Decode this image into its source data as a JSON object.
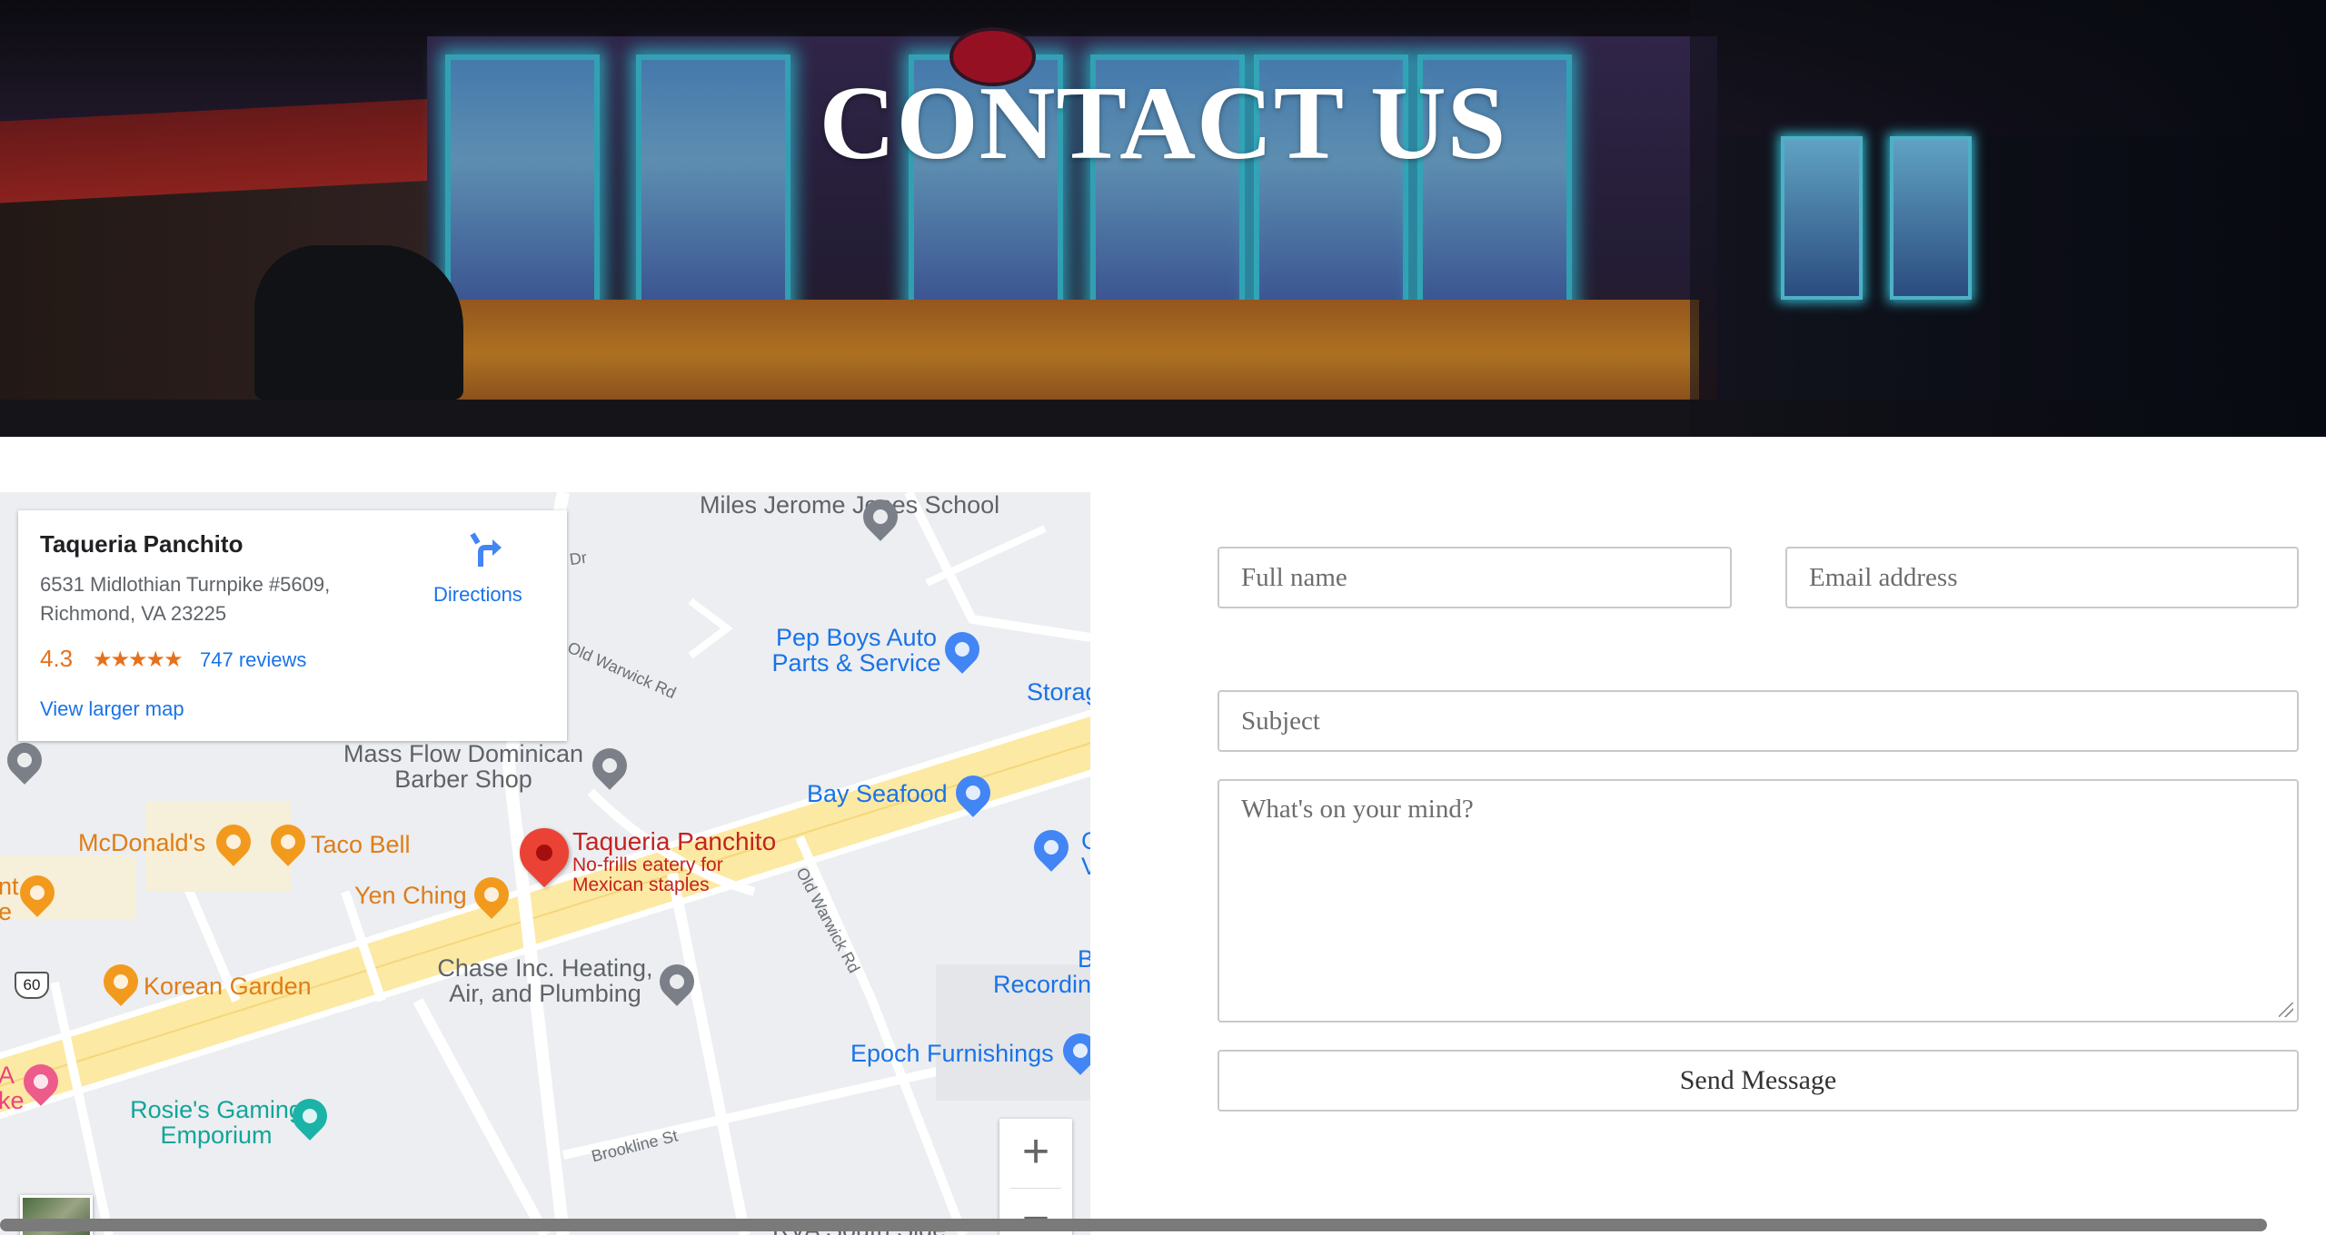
{
  "hero": {
    "title": "CONTACT US"
  },
  "map": {
    "place": {
      "name": "Taqueria Panchito",
      "address": "6531 Midlothian Turnpike #5609, Richmond, VA 23225",
      "rating": "4.3",
      "stars": "★★★★★",
      "reviews": "747 reviews",
      "directions_label": "Directions",
      "larger_map_label": "View larger map",
      "description": "No-frills eatery for Mexican staples"
    },
    "pois": {
      "miles_jerome": "Miles Jerome Jones School",
      "pep_boys": "Pep Boys Auto Parts & Service",
      "storage": "Storag",
      "mass_flow": "Mass Flow Dominican Barber Shop",
      "bay_seafood": "Bay Seafood",
      "mcdonalds": "McDonald's",
      "taco_bell": "Taco Bell",
      "yen_ching": "Yen Ching",
      "korean_garden": "Korean Garden",
      "chase": "Chase Inc. Heating, Air, and Plumbing",
      "recording": "Recordin",
      "recording_b": "B",
      "epoch": "Epoch Furnishings",
      "rosies": "Rosie's Gaming Emporium",
      "rva": "RVA South Side",
      "left_nt": "nt",
      "left_e": "e",
      "left_a": "A",
      "left_ke": "ke",
      "g_letter": "G",
      "v_letter": "V"
    },
    "streets": {
      "old_warwick_1": "Old Warwick Rd",
      "old_warwick_2": "Old Warwick Rd",
      "brookline": "Brookline St",
      "dr": "e Dr",
      "route": "60"
    },
    "zoom_in": "+",
    "zoom_out": "−"
  },
  "form": {
    "full_name_placeholder": "Full name",
    "email_placeholder": "Email address",
    "subject_placeholder": "Subject",
    "message_placeholder": "What's on your mind?",
    "send_label": "Send Message"
  }
}
